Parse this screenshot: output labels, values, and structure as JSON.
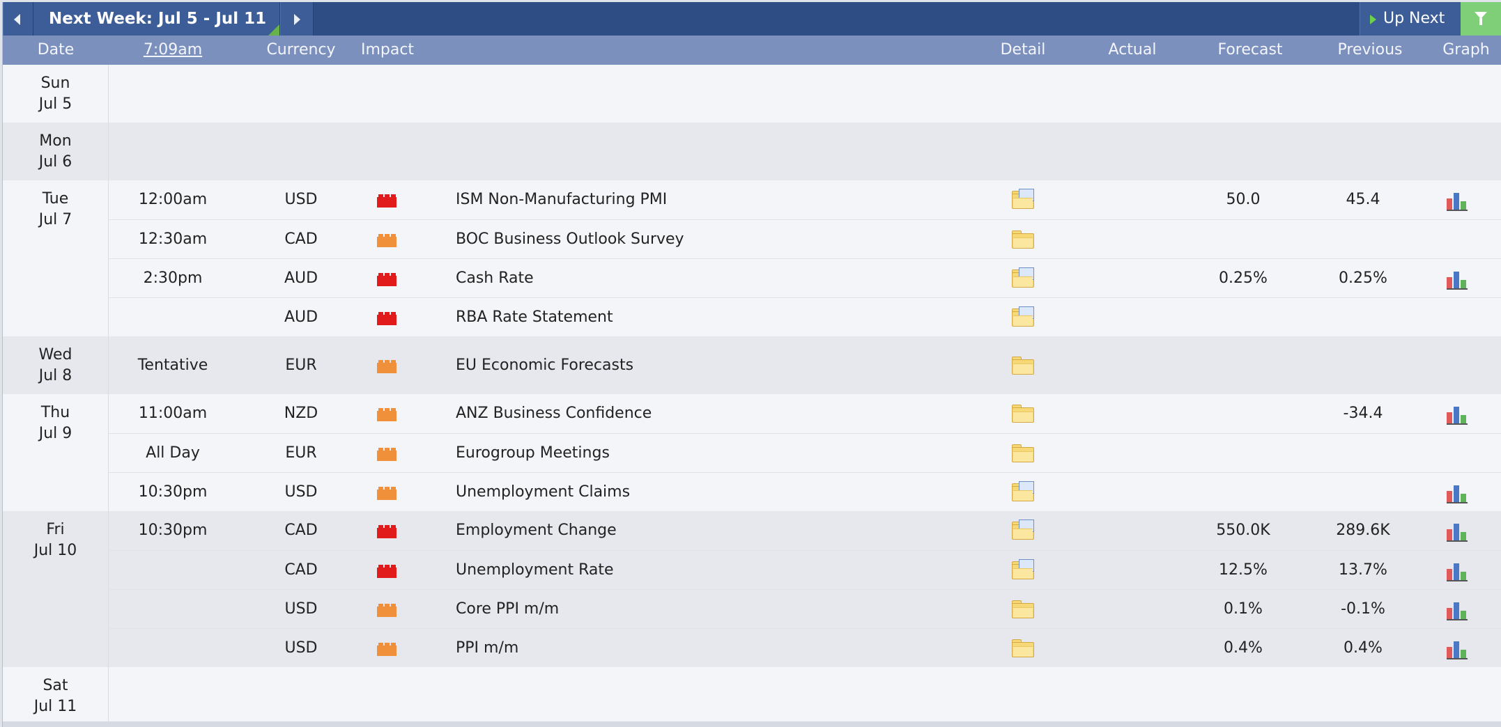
{
  "topbar": {
    "week_title": "Next Week: Jul 5 - Jul 11",
    "up_next_label": "Up Next"
  },
  "header": {
    "date": "Date",
    "time": "7:09am",
    "currency": "Currency",
    "impact": "Impact",
    "detail": "Detail",
    "actual": "Actual",
    "forecast": "Forecast",
    "previous": "Previous",
    "graph": "Graph"
  },
  "colors": {
    "high_impact": "#e11b1b",
    "medium_impact": "#f0903a",
    "topbar": "#2f4d85",
    "header": "#7b90bd",
    "filter": "#7fcf79"
  },
  "days": [
    {
      "dow": "Sun",
      "date": "Jul 5",
      "events": []
    },
    {
      "dow": "Mon",
      "date": "Jul 6",
      "events": []
    },
    {
      "dow": "Tue",
      "date": "Jul 7",
      "events": [
        {
          "time": "12:00am",
          "currency": "USD",
          "impact": "high",
          "event": "ISM Non-Manufacturing PMI",
          "detail": "folder-doc",
          "actual": "",
          "forecast": "50.0",
          "previous": "45.4",
          "graph": true
        },
        {
          "time": "12:30am",
          "currency": "CAD",
          "impact": "medium",
          "event": "BOC Business Outlook Survey",
          "detail": "folder",
          "actual": "",
          "forecast": "",
          "previous": "",
          "graph": false
        },
        {
          "time": "2:30pm",
          "currency": "AUD",
          "impact": "high",
          "event": "Cash Rate",
          "detail": "folder-doc",
          "actual": "",
          "forecast": "0.25%",
          "previous": "0.25%",
          "graph": true
        },
        {
          "time": "",
          "currency": "AUD",
          "impact": "high",
          "event": "RBA Rate Statement",
          "detail": "folder-doc",
          "actual": "",
          "forecast": "",
          "previous": "",
          "graph": false
        }
      ]
    },
    {
      "dow": "Wed",
      "date": "Jul 8",
      "events": [
        {
          "time": "Tentative",
          "currency": "EUR",
          "impact": "medium",
          "event": "EU Economic Forecasts",
          "detail": "folder",
          "actual": "",
          "forecast": "",
          "previous": "",
          "graph": false
        }
      ]
    },
    {
      "dow": "Thu",
      "date": "Jul 9",
      "events": [
        {
          "time": "11:00am",
          "currency": "NZD",
          "impact": "medium",
          "event": "ANZ Business Confidence",
          "detail": "folder",
          "actual": "",
          "forecast": "",
          "previous": "-34.4",
          "graph": true
        },
        {
          "time": "All Day",
          "currency": "EUR",
          "impact": "medium",
          "event": "Eurogroup Meetings",
          "detail": "folder",
          "actual": "",
          "forecast": "",
          "previous": "",
          "graph": false
        },
        {
          "time": "10:30pm",
          "currency": "USD",
          "impact": "medium",
          "event": "Unemployment Claims",
          "detail": "folder-doc",
          "actual": "",
          "forecast": "",
          "previous": "",
          "graph": true
        }
      ]
    },
    {
      "dow": "Fri",
      "date": "Jul 10",
      "events": [
        {
          "time": "10:30pm",
          "currency": "CAD",
          "impact": "high",
          "event": "Employment Change",
          "detail": "folder-doc",
          "actual": "",
          "forecast": "550.0K",
          "previous": "289.6K",
          "graph": true
        },
        {
          "time": "",
          "currency": "CAD",
          "impact": "high",
          "event": "Unemployment Rate",
          "detail": "folder-doc",
          "actual": "",
          "forecast": "12.5%",
          "previous": "13.7%",
          "graph": true
        },
        {
          "time": "",
          "currency": "USD",
          "impact": "medium",
          "event": "Core PPI m/m",
          "detail": "folder",
          "actual": "",
          "forecast": "0.1%",
          "previous": "-0.1%",
          "graph": true
        },
        {
          "time": "",
          "currency": "USD",
          "impact": "medium",
          "event": "PPI m/m",
          "detail": "folder",
          "actual": "",
          "forecast": "0.4%",
          "previous": "0.4%",
          "graph": true
        }
      ]
    },
    {
      "dow": "Sat",
      "date": "Jul 11",
      "events": []
    }
  ]
}
